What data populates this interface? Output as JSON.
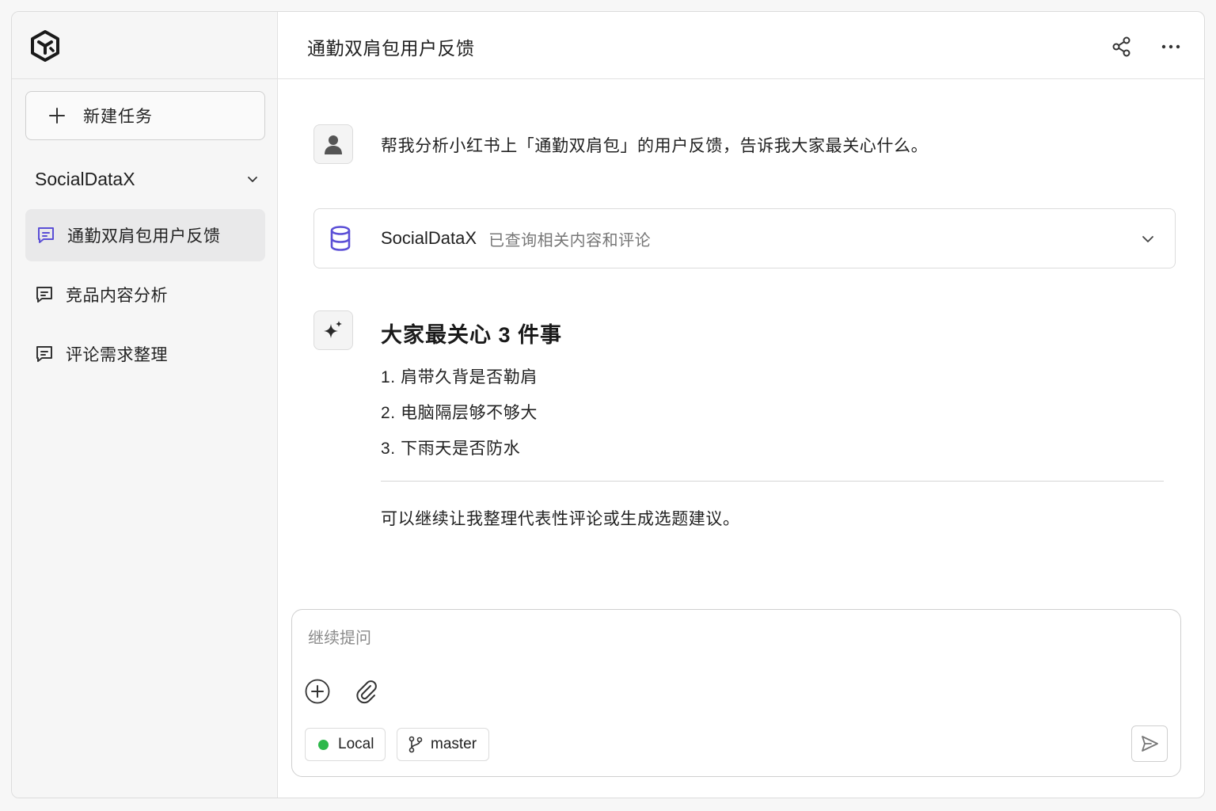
{
  "sidebar": {
    "new_task_label": "新建任务",
    "workspace_name": "SocialDataX",
    "conversations": [
      {
        "label": "通勤双肩包用户反馈",
        "active": true
      },
      {
        "label": "竞品内容分析",
        "active": false
      },
      {
        "label": "评论需求整理",
        "active": false
      }
    ]
  },
  "header": {
    "title": "通勤双肩包用户反馈"
  },
  "chat": {
    "user_message": "帮我分析小红书上「通勤双肩包」的用户反馈，告诉我大家最关心什么。",
    "tool": {
      "name": "SocialDataX",
      "status": "已查询相关内容和评论"
    },
    "answer": {
      "title": "大家最关心 3 件事",
      "items": [
        "1.  肩带久背是否勒肩",
        "2.  电脑隔层够不够大",
        "3.  下雨天是否防水"
      ],
      "followup": "可以继续让我整理代表性评论或生成选题建议。"
    }
  },
  "composer": {
    "placeholder": "继续提问",
    "env_label": "Local",
    "branch_label": "master"
  },
  "colors": {
    "accent": "#5b4fd6",
    "status_green": "#2db84a"
  },
  "icons": {
    "logo": "cube-logo-icon",
    "new_task": "plus-icon",
    "workspace_toggle": "chevron-down-icon",
    "conversation": "chat-bubble-icon",
    "share": "share-icon",
    "more": "more-horizontal-icon",
    "user_avatar": "user-icon",
    "tool": "database-icon",
    "assistant": "sparkle-icon",
    "attach_add": "plus-circle-icon",
    "attach_file": "paperclip-icon",
    "branch": "git-branch-icon",
    "send": "send-icon"
  }
}
